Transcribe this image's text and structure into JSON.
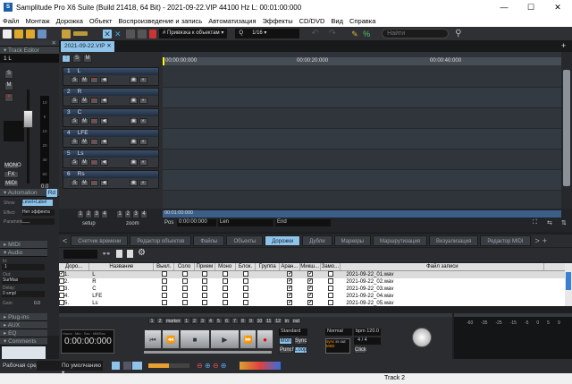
{
  "window": {
    "title": "Samplitude Pro X6 Suite (Build 21418, 64 Bit)  -  2021-09-22.VIP   44100 Hz L: 00:01:00:000",
    "minimize": "—",
    "maximize": "☐",
    "close": "✕"
  },
  "menu": [
    "Файл",
    "Монтаж",
    "Дорожка",
    "Объект",
    "Воспроизведение и запись",
    "Автоматизация",
    "Эффекты",
    "CD/DVD",
    "Вид",
    "Справка"
  ],
  "toolbar": {
    "snap_label": "Привязка к объектам",
    "quantize_label": "Q",
    "quantize_value": "1/16",
    "search_placeholder": "Найти"
  },
  "left_panel": {
    "track_editor_title": "Track Editor",
    "track_selector": "1   L",
    "buttons": {
      "solo": "S",
      "mute": "M",
      "mono": "MONO",
      "fx": "FX",
      "midi": "MIDI"
    },
    "fader_scale": [
      "10",
      "0",
      "10",
      "20",
      "40",
      "60"
    ],
    "fader_value": "0.0",
    "automation_title": "Automation",
    "automation_mode": "Rd",
    "show_label": "Show",
    "show_value": "Level+Label",
    "effect_label": "Effect",
    "effect_value": "Нет эффекта",
    "parameter_label": "Parameter",
    "parameter_value": "___",
    "sections": {
      "midi": "MIDI",
      "audio": "Audio",
      "plugins": "Plug-ins",
      "aux": "AUX",
      "eq": "EQ",
      "comments": "Comments"
    },
    "in_label": "In:",
    "in_value": "1",
    "out_label": "Out:",
    "out_value": "SurMas",
    "delay_label": "Delay:",
    "delay_value": "0 smpl",
    "gain_label": "Gain:",
    "gain_value": "0.0"
  },
  "project": {
    "tab": "2021-09-22.VIP",
    "solo": "S",
    "mute": "M"
  },
  "tracks": [
    {
      "num": "1",
      "name": "L"
    },
    {
      "num": "2",
      "name": "R"
    },
    {
      "num": "3",
      "name": "C"
    },
    {
      "num": "4",
      "name": "LFE"
    },
    {
      "num": "5",
      "name": "Ls"
    },
    {
      "num": "6",
      "name": "Rs"
    }
  ],
  "track_buttons": [
    "S",
    "M",
    "●",
    "◀",
    "▣",
    "◐"
  ],
  "ruler": [
    "00:00:00:000",
    "00:00:20:000",
    "00:00:40:000"
  ],
  "arrange_bottom": {
    "setup": "setup",
    "zoom": "zoom",
    "presets": [
      "1",
      "2",
      "3",
      "4"
    ],
    "overview_time": "00:01:00:000",
    "pos_label": "Pos",
    "pos_value": "0:00:00:000",
    "len_label": "Len",
    "end_label": "End"
  },
  "manager_tabs": [
    "Счетчик времени",
    "Редактор объектов",
    "Файлы",
    "Объекты",
    "Дорожки",
    "Дубли",
    "Маркеры",
    "Маршрутизация",
    "Визуализация",
    "Редактор MIDI"
  ],
  "active_tab": "Дорожки",
  "table": {
    "headers": [
      "Доро...",
      "Название",
      "Выкл.",
      "Соло",
      "Прием",
      "Моно",
      "Блок.",
      "Группа",
      "Аран...",
      "Микш...",
      "Замо...",
      "Файл записи"
    ],
    "rows": [
      {
        "num": "1.",
        "name": "L",
        "sel": true,
        "file": "2021-09-22_01.wav"
      },
      {
        "num": "2.",
        "name": "R",
        "sel": false,
        "file": "2021-09-22_02.wav"
      },
      {
        "num": "3.",
        "name": "C",
        "sel": false,
        "file": "2021-09-22_03.wav"
      },
      {
        "num": "4.",
        "name": "LFE",
        "sel": false,
        "file": "2021-09-22_04.wav"
      },
      {
        "num": "5.",
        "name": "Ls",
        "sel": false,
        "file": "2021-09-22_05.wav"
      }
    ]
  },
  "transport": {
    "markers": [
      "1",
      "2",
      "marker",
      "1",
      "2",
      "3",
      "4",
      "5",
      "6",
      "7",
      "8",
      "9",
      "10",
      "11",
      "12",
      "in",
      "out"
    ],
    "time_format": "Hours : Min : Sec : MilliSec",
    "time": "0:00:00:000",
    "mode": "Standard",
    "mon": "Mon",
    "sync": "Sync",
    "punch": "Punch",
    "loop": "Loop",
    "play_mode": "Normal",
    "bpm": "bpm 120.0",
    "signature": "4 / 4",
    "sync_label": "sync",
    "midi_label": "MIDI",
    "in": "in",
    "out": "out",
    "click": "Click"
  },
  "meter_scale": [
    "-60",
    "-35",
    "-25",
    "-15",
    "-5",
    "0",
    "5",
    "9"
  ],
  "workspace": {
    "label": "Рабочая среда:",
    "value": "По умолчанию"
  },
  "status": {
    "text": "Track 2"
  }
}
